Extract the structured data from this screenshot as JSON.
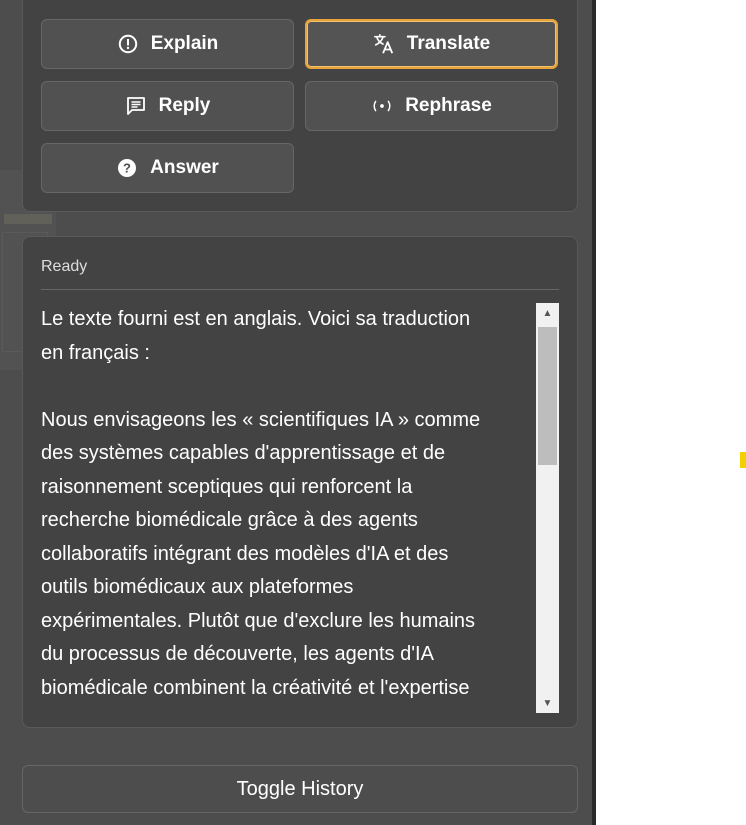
{
  "actions": {
    "explain": {
      "label": "Explain",
      "icon": "info-circle-icon"
    },
    "translate": {
      "label": "Translate",
      "icon": "translate-icon",
      "selected": true,
      "accent": "#e8a33c"
    },
    "reply": {
      "label": "Reply",
      "icon": "message-icon"
    },
    "rephrase": {
      "label": "Rephrase",
      "icon": "rephrase-icon"
    },
    "answer": {
      "label": "Answer",
      "icon": "question-circle-icon"
    }
  },
  "result": {
    "status": "Ready",
    "text": "Le texte fourni est en anglais. Voici sa traduction\nen français :\n\nNous envisageons les « scientifiques IA » comme\ndes systèmes capables d'apprentissage et de\nraisonnement sceptiques qui renforcent la\nrecherche biomédicale grâce à des agents\ncollaboratifs intégrant des modèles d'IA et des\noutils biomédicaux aux plateformes\nexpérimentales. Plutôt que d'exclure les humains\ndu processus de découverte, les agents d'IA\nbiomédicale combinent la créativité et l'expertise"
  },
  "footer": {
    "toggle_history_label": "Toggle History"
  },
  "colors": {
    "panel": "#4d4d4d",
    "card": "#434343",
    "accent": "#e8a33c",
    "marker": "#f5d000"
  }
}
